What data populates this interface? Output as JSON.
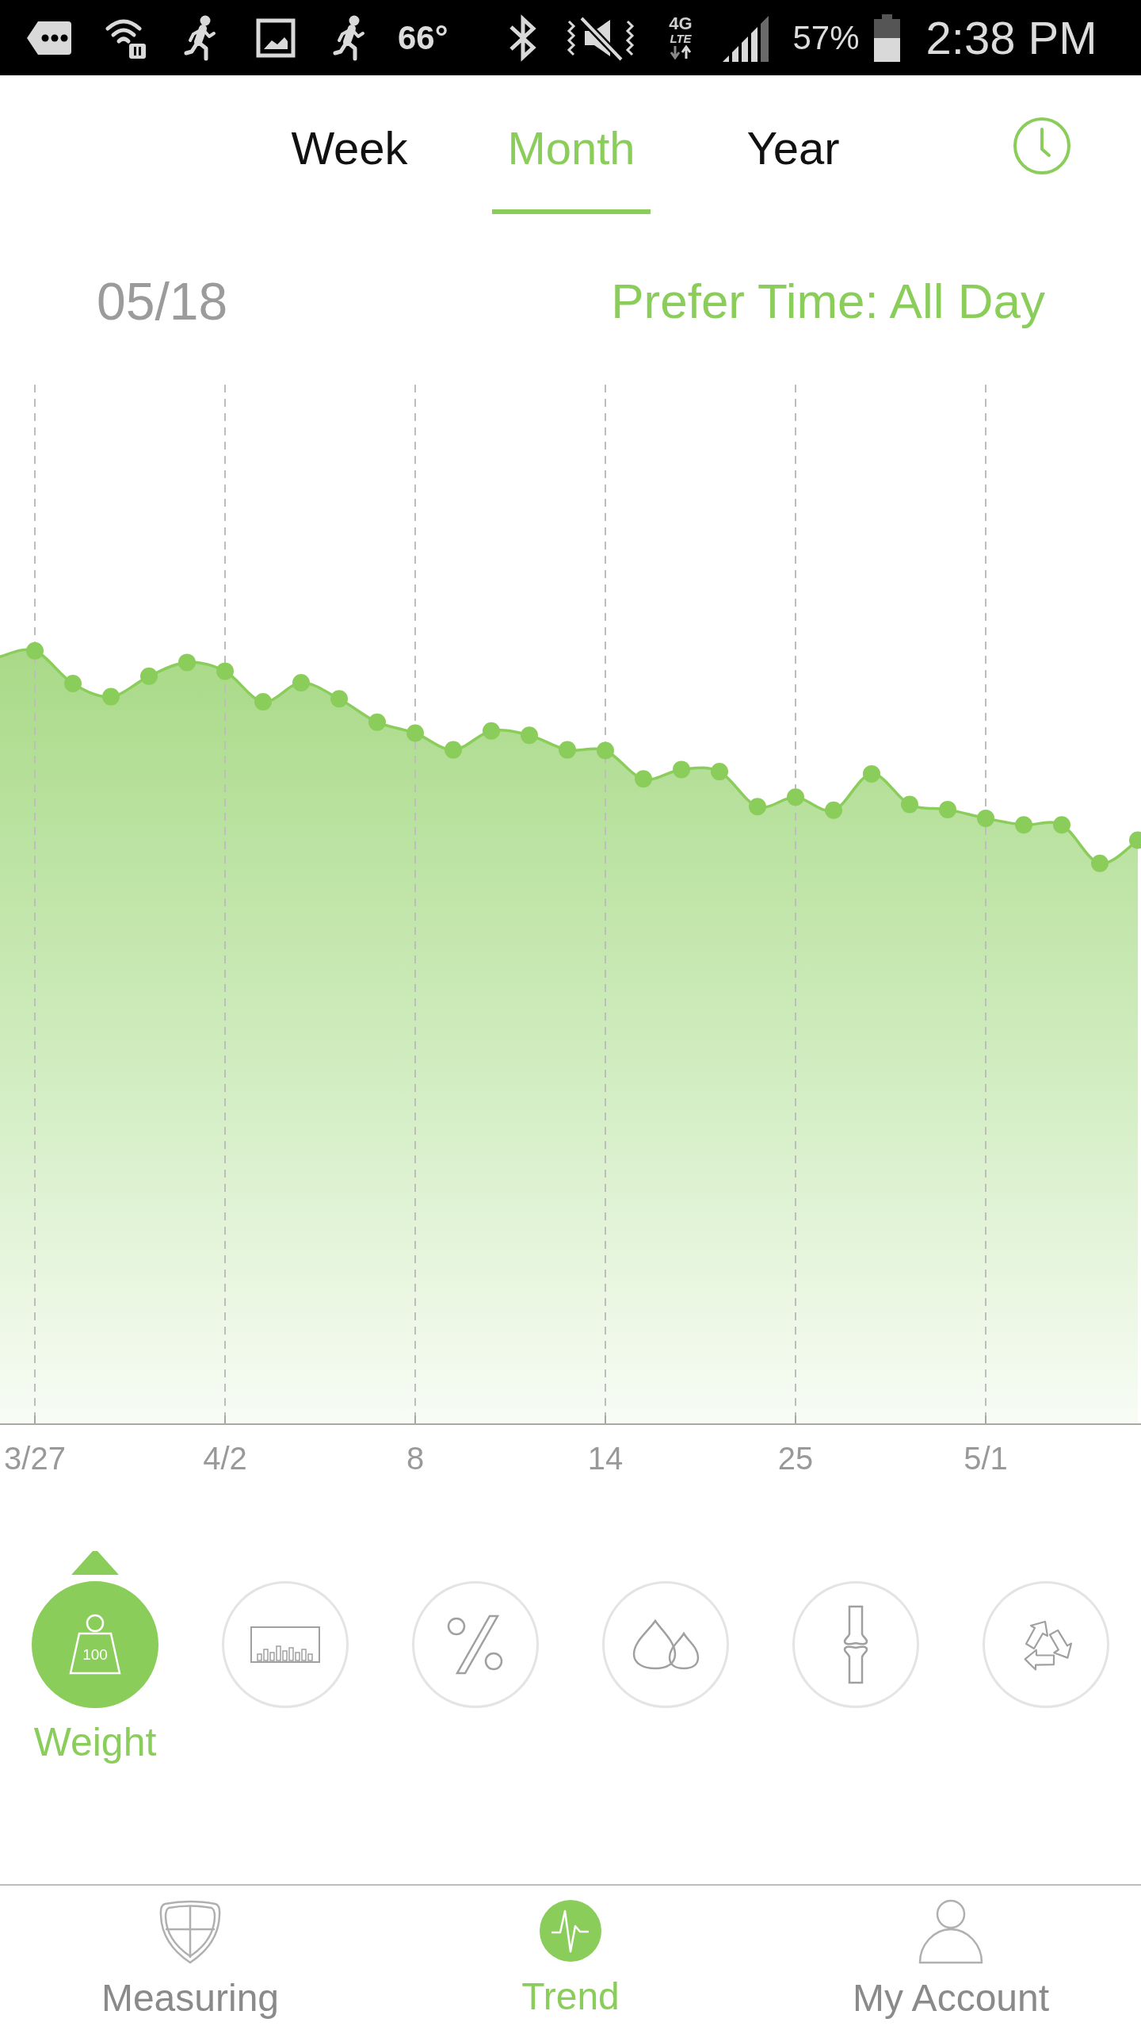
{
  "status_bar": {
    "temperature": "66°",
    "network": "4G",
    "network_detail": "LTE",
    "battery": "57%",
    "time": "2:38 PM"
  },
  "tabs": [
    {
      "label": "Week",
      "selected": false
    },
    {
      "label": "Month",
      "selected": true
    },
    {
      "label": "Year",
      "selected": false
    }
  ],
  "summary": {
    "date": "05/18",
    "prefer_time": "Prefer Time: All Day"
  },
  "chart": {
    "x_labels": [
      "3/27",
      "4/2",
      "8",
      "14",
      "25",
      "5/1"
    ]
  },
  "metrics": [
    {
      "kind": "weight",
      "icon_text": "100",
      "label": "Weight",
      "selected": true
    },
    {
      "kind": "bars",
      "selected": false
    },
    {
      "kind": "percent",
      "selected": false
    },
    {
      "kind": "water",
      "selected": false
    },
    {
      "kind": "bone",
      "selected": false
    },
    {
      "kind": "recycle",
      "selected": false
    }
  ],
  "nav": [
    {
      "kind": "measuring",
      "label": "Measuring",
      "selected": false
    },
    {
      "kind": "trend",
      "label": "Trend",
      "selected": true
    },
    {
      "kind": "account",
      "label": "My Account",
      "selected": false
    }
  ]
}
